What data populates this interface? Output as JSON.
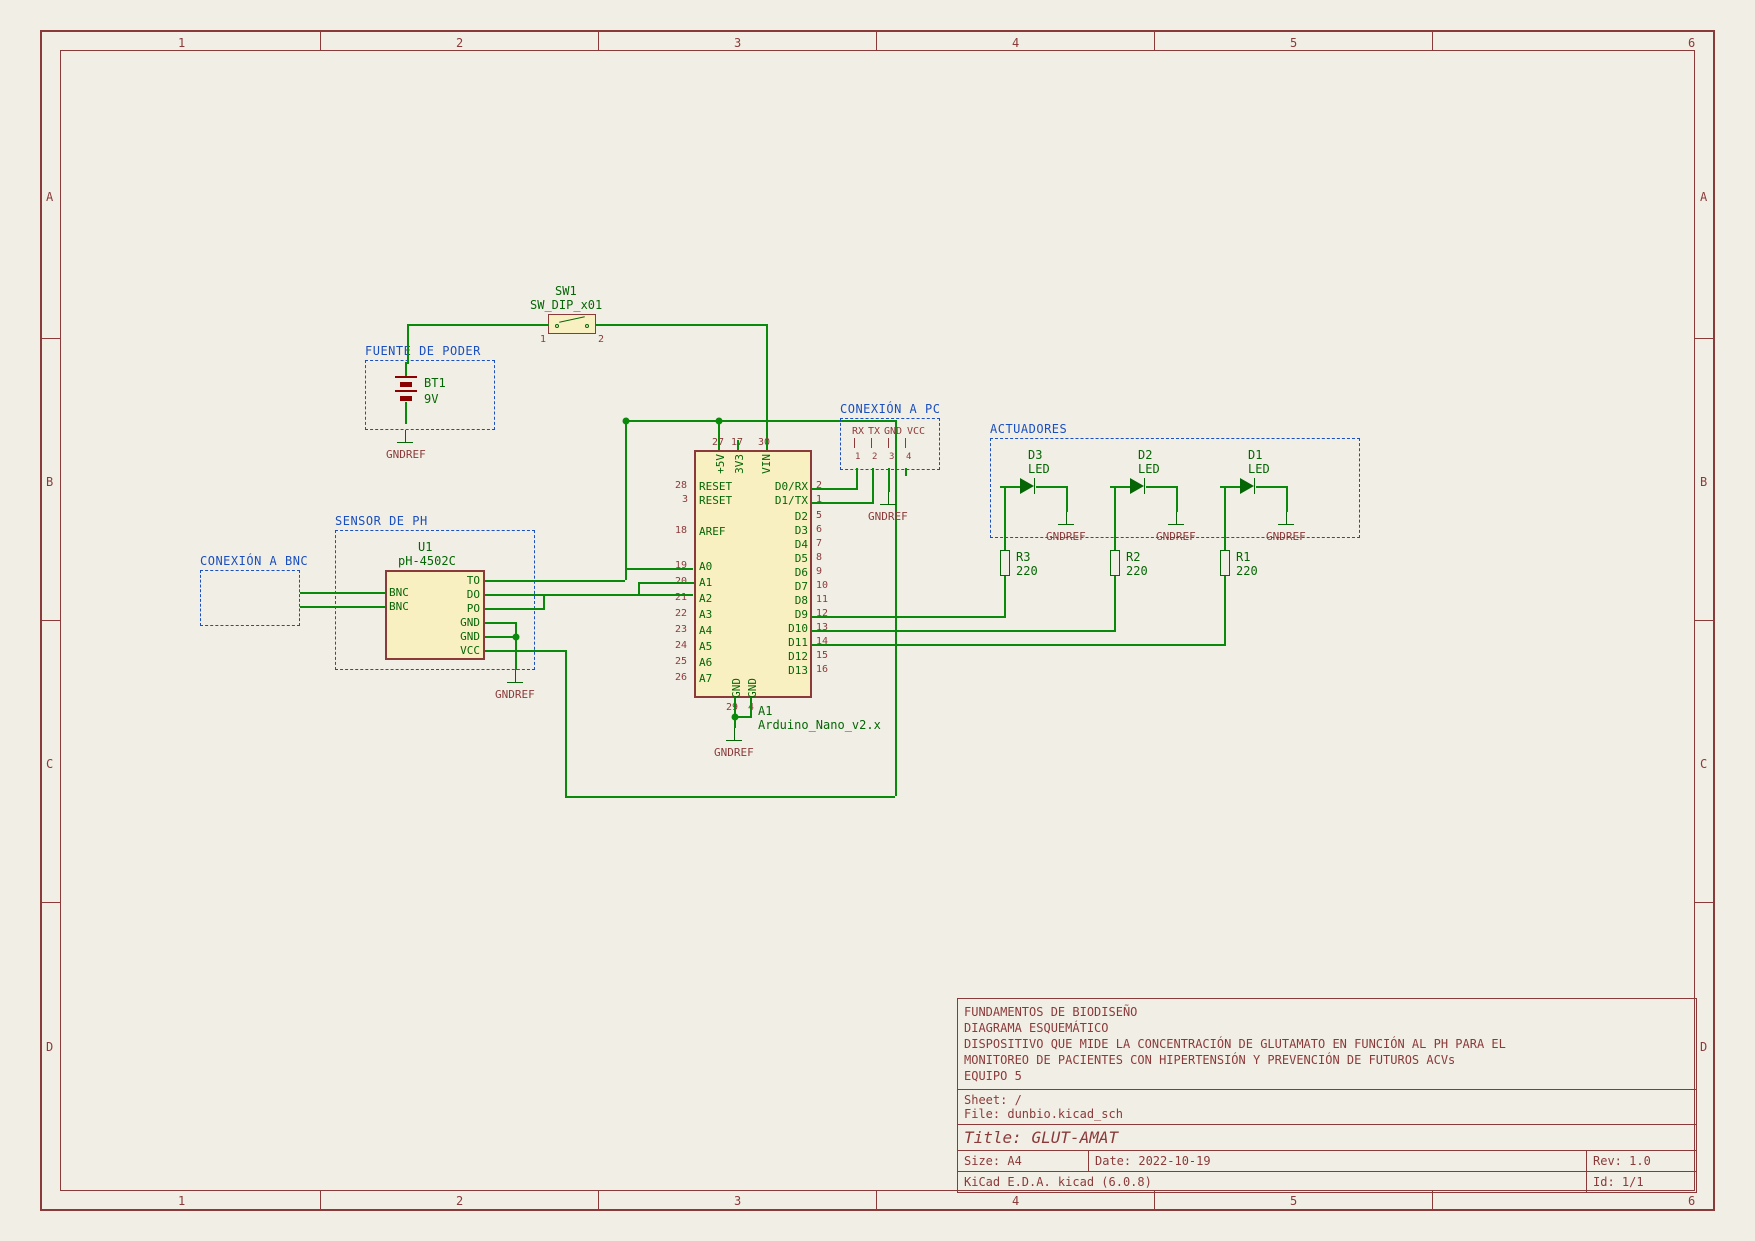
{
  "frame": {
    "ruler_cols": [
      "1",
      "2",
      "3",
      "4",
      "5",
      "6"
    ],
    "ruler_rows": [
      "A",
      "B",
      "C",
      "D"
    ]
  },
  "groups": {
    "fuente": "FUENTE DE PODER",
    "sensor": "SENSOR DE PH",
    "bnc": "CONEXIÓN A BNC",
    "pc": "CONEXIÓN A PC",
    "act": "ACTUADORES"
  },
  "components": {
    "battery": {
      "ref": "BT1",
      "val": "9V"
    },
    "switch": {
      "ref": "SW1",
      "val": "SW_DIP_x01",
      "p1": "1",
      "p2": "2"
    },
    "ph": {
      "ref": "U1",
      "val": "pH-4502C",
      "pins_left": [
        "BNC",
        "BNC"
      ],
      "pins_right": [
        "TO",
        "DO",
        "PO",
        "GND",
        "GND",
        "VCC"
      ]
    },
    "arduino": {
      "ref": "A1",
      "val": "Arduino_Nano_v2.x",
      "top": [
        "+5V",
        "3V3",
        "VIN"
      ],
      "top_nums": [
        "27",
        "17",
        "30"
      ],
      "left": [
        "RESET",
        "RESET",
        "AREF",
        "A0",
        "A1",
        "A2",
        "A3",
        "A4",
        "A5",
        "A6",
        "A7"
      ],
      "left_nums": [
        "28",
        "3",
        "18",
        "19",
        "20",
        "21",
        "22",
        "23",
        "24",
        "25",
        "26"
      ],
      "right": [
        "D0/RX",
        "D1/TX",
        "D2",
        "D3",
        "D4",
        "D5",
        "D6",
        "D7",
        "D8",
        "D9",
        "D10",
        "D11",
        "D12",
        "D13"
      ],
      "right_nums": [
        "2",
        "1",
        "5",
        "6",
        "7",
        "8",
        "9",
        "10",
        "11",
        "12",
        "13",
        "14",
        "15",
        "16"
      ],
      "bottom": [
        "GND",
        "GND"
      ],
      "bottom_nums": [
        "29",
        "4"
      ]
    },
    "pc_conn": {
      "labels": [
        "RX",
        "TX",
        "GND",
        "VCC"
      ],
      "nums": [
        "1",
        "2",
        "3",
        "4"
      ]
    },
    "leds": [
      {
        "ref": "D3",
        "val": "LED",
        "r_ref": "R3",
        "r_val": "220"
      },
      {
        "ref": "D2",
        "val": "LED",
        "r_ref": "R2",
        "r_val": "220"
      },
      {
        "ref": "D1",
        "val": "LED",
        "r_ref": "R1",
        "r_val": "220"
      }
    ]
  },
  "net_gnd": "GNDREF",
  "title_block": {
    "line1": "FUNDAMENTOS DE BIODISEÑO",
    "line2": "DIAGRAMA ESQUEMÁTICO",
    "line3": "DISPOSITIVO QUE MIDE LA CONCENTRACIÓN DE GLUTAMATO EN FUNCIÓN AL PH PARA EL",
    "line4": "MONITOREO DE PACIENTES CON HIPERTENSIÓN Y PREVENCIÓN DE FUTUROS ACVs",
    "line5": "EQUIPO 5",
    "sheet": "Sheet: /",
    "file": "File: dunbio.kicad_sch",
    "title_label": "Title:",
    "title": "GLUT-AMAT",
    "size": "Size: A4",
    "date": "Date: 2022-10-19",
    "rev": "Rev: 1.0",
    "tool": "KiCad E.D.A.  kicad (6.0.8)",
    "id": "Id: 1/1"
  }
}
